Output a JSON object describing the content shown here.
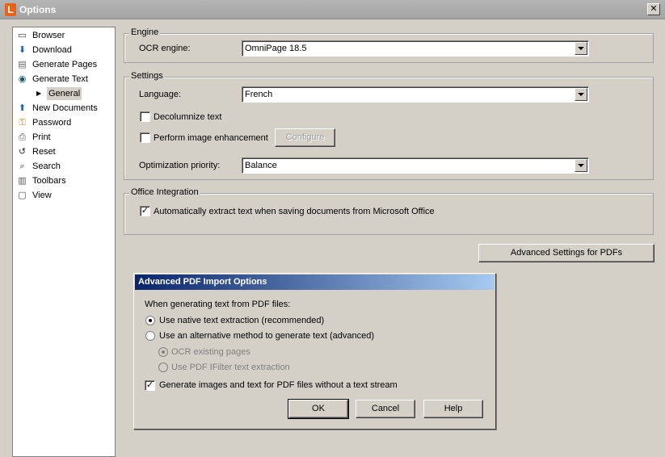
{
  "window": {
    "app_icon": "L",
    "title": "Options",
    "close": "✕"
  },
  "sidebar": {
    "items": [
      {
        "label": "Browser",
        "icon": "browser-icon",
        "glyph": "▭"
      },
      {
        "label": "Download",
        "icon": "download-icon",
        "glyph": "⬇"
      },
      {
        "label": "Generate Pages",
        "icon": "generate-pages-icon",
        "glyph": "▤"
      },
      {
        "label": "Generate Text",
        "icon": "generate-text-icon",
        "glyph": "◉"
      },
      {
        "label": "General",
        "icon": "expand-arrow-icon",
        "glyph": "▶",
        "sub": true
      },
      {
        "label": "New Documents",
        "icon": "new-documents-icon",
        "glyph": "⬆"
      },
      {
        "label": "Password",
        "icon": "key-icon",
        "glyph": "⚿"
      },
      {
        "label": "Print",
        "icon": "printer-icon",
        "glyph": "⎙"
      },
      {
        "label": "Reset",
        "icon": "reset-icon",
        "glyph": "↺"
      },
      {
        "label": "Search",
        "icon": "search-icon",
        "glyph": "⌕"
      },
      {
        "label": "Toolbars",
        "icon": "toolbars-icon",
        "glyph": "▥"
      },
      {
        "label": "View",
        "icon": "view-icon",
        "glyph": "▢"
      }
    ]
  },
  "engine": {
    "group_title": "Engine",
    "ocr_label": "OCR engine:",
    "ocr_value": "OmniPage 18.5"
  },
  "settings": {
    "group_title": "Settings",
    "language_label": "Language:",
    "language_value": "French",
    "decolumnize_label": "Decolumnize text",
    "decolumnize_checked": false,
    "enhancement_label": "Perform image enhancement",
    "enhancement_checked": false,
    "configure_label": "Configure",
    "priority_label": "Optimization priority:",
    "priority_value": "Balance"
  },
  "office": {
    "group_title": "Office Integration",
    "extract_label": "Automatically extract text when saving documents from Microsoft Office",
    "extract_checked": true,
    "check_mark": "✓"
  },
  "advanced_button_label": "Advanced Settings for PDFs",
  "pdf_dialog": {
    "title": "Advanced PDF Import Options",
    "intro": "When generating text from PDF files:",
    "native_label": "Use native text extraction (recommended)",
    "alternative_label": "Use an alternative method to generate text (advanced)",
    "ocr_label": "OCR existing pages",
    "ifilter_label": "Use PDF IFilter text extraction",
    "generate_images_label": "Generate images and text for PDF files without a text stream",
    "generate_images_checked": true,
    "ok_label": "OK",
    "cancel_label": "Cancel",
    "help_label": "Help"
  },
  "colors": {
    "dialog_title_start": "#0a246a",
    "dialog_title_end": "#a6caf0",
    "window_bg": "#d4d0c8",
    "app_icon": "#e8631a"
  }
}
